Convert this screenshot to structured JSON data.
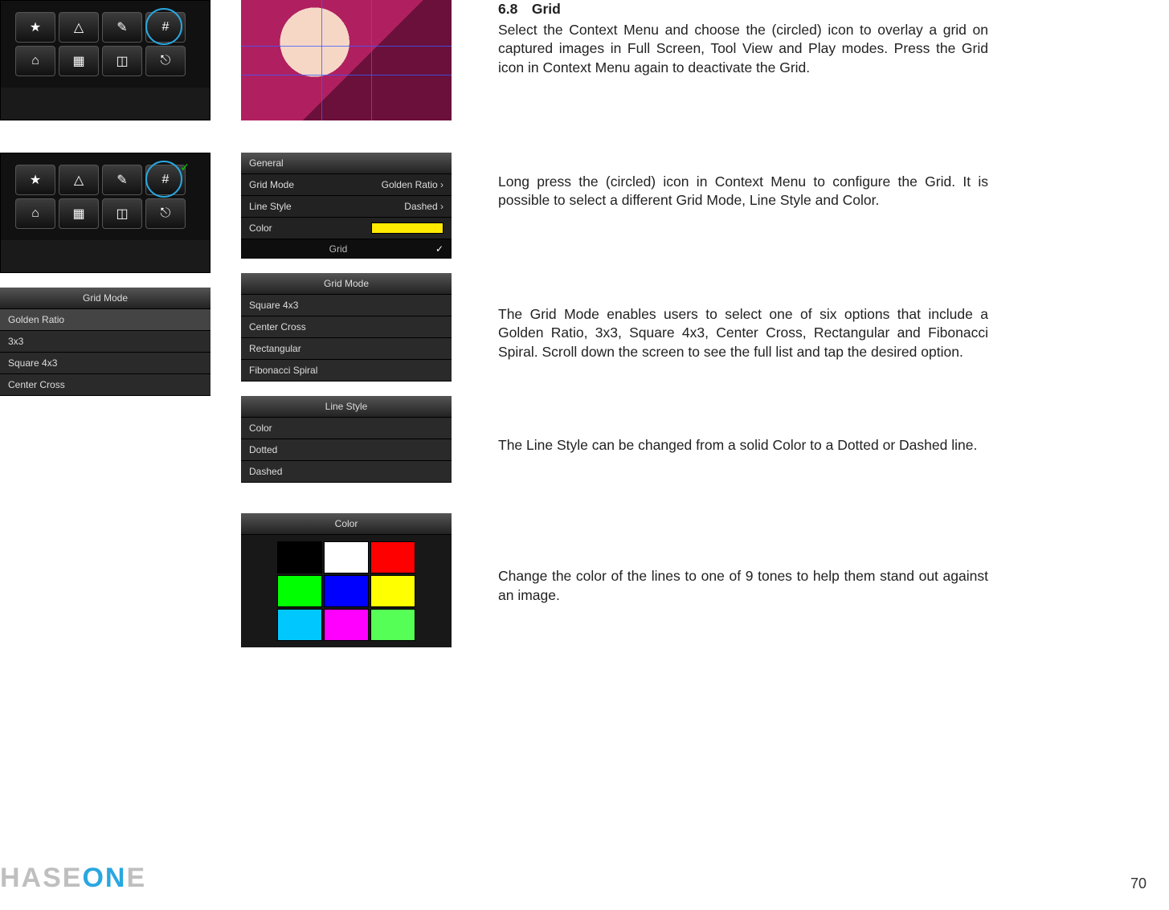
{
  "section": {
    "title": "6.8  Grid"
  },
  "paras": {
    "p1": "Select the Context Menu and choose the (circled) icon to overlay a grid on captured images in Full Screen, Tool View and Play modes. Press the Grid icon in Context Menu again to deactivate the Grid.",
    "p2": "Long press the (circled) icon in Context Menu to configure the Grid. It is possible to select a different Grid Mode, Line Style and Color.",
    "p3": "The Grid Mode enables users to select one of six options that include a Golden Ratio, 3x3, Square 4x3, Center Cross, Rectangular and Fibonacci Spiral. Scroll down the screen to see the full list and tap the desired option.",
    "p4": "The Line Style can be changed from a solid Color to a Dotted or Dashed line.",
    "p5": "Change the color of the lines to one of 9 tones to help them stand out against an image."
  },
  "context_icons": [
    "star",
    "warning",
    "eyedropper",
    "grid",
    "home",
    "thumbnails",
    "dual",
    "video"
  ],
  "settings_panel": {
    "header": "General",
    "rows": [
      {
        "label": "Grid Mode",
        "value": "Golden Ratio"
      },
      {
        "label": "Line Style",
        "value": "Dashed"
      },
      {
        "label": "Color",
        "value_swatch": "#ffea00"
      }
    ],
    "footer": "Grid"
  },
  "grid_mode_a": {
    "header": "Grid Mode",
    "options": [
      "Golden Ratio",
      "3x3",
      "Square 4x3",
      "Center Cross"
    ],
    "selected": "Golden Ratio"
  },
  "grid_mode_b": {
    "header": "Grid Mode",
    "options": [
      "Square 4x3",
      "Center Cross",
      "Rectangular",
      "Fibonacci Spiral"
    ]
  },
  "line_style": {
    "header": "Line Style",
    "options": [
      "Color",
      "Dotted",
      "Dashed"
    ]
  },
  "color_panel": {
    "header": "Color",
    "swatches": [
      "#000000",
      "#ffffff",
      "#ff0000",
      "#00ff00",
      "#0000ff",
      "#ffff00",
      "#00c8ff",
      "#ff00ff",
      "#55ff55"
    ]
  },
  "logo": {
    "a": "HASE",
    "b": "ON",
    "c": "E"
  },
  "page_number": "70"
}
